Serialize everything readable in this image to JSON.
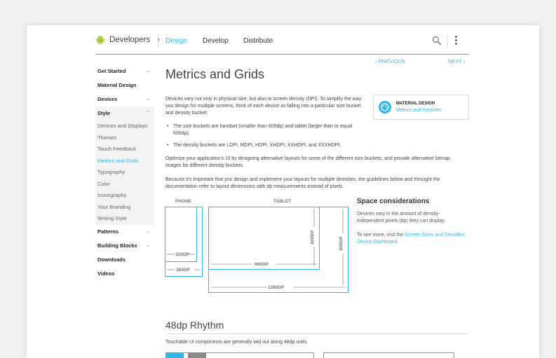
{
  "header": {
    "brand": "Developers",
    "nav": [
      "Design",
      "Develop",
      "Distribute"
    ],
    "active_nav": "Design"
  },
  "icons": [
    "android-icon",
    "search-icon",
    "more-vert-icon",
    "palette-icon"
  ],
  "colors": {
    "accent": "#33b5e5",
    "android_green": "#a4c639"
  },
  "sidebar": {
    "items": [
      {
        "label": "Get Started",
        "chevron": true
      },
      {
        "label": "Material Design"
      },
      {
        "label": "Devices",
        "chevron": true
      },
      {
        "label": "Style",
        "chevron": true
      },
      {
        "label": "Devices and Displays"
      },
      {
        "label": "Themes"
      },
      {
        "label": "Touch Feedback"
      },
      {
        "label": "Metrics and Grids",
        "active": true
      },
      {
        "label": "Typography"
      },
      {
        "label": "Color"
      },
      {
        "label": "Iconography"
      },
      {
        "label": "Your Branding"
      },
      {
        "label": "Writing Style"
      },
      {
        "label": "Patterns",
        "chevron": true
      },
      {
        "label": "Building Blocks",
        "chevron": true
      },
      {
        "label": "Downloads"
      },
      {
        "label": "Videos"
      }
    ]
  },
  "pager": {
    "previous": "‹ PREVIOUS",
    "next": "NEXT ›"
  },
  "main": {
    "title": "Metrics and Grids",
    "intro": "Devices vary not only in physical size, but also in screen density (DPI). To simplify the way you design for multiple screens, think of each device as falling into a particular size bucket and density bucket:",
    "bullets": [
      "The size buckets are handset (smaller than 600dp) and tablet (larger than or equal 600dp).",
      "The density buckets are LDPI, MDPI, HDPI, XHDPI, XXHDPI, and XXXHDPI."
    ],
    "para2": "Optimize your application's UI by designing alternative layouts for some of the different size buckets, and provide alternative bitmap images for different density buckets.",
    "para3": "Because it's important that you design and implement your layouts for multiple densities, the guidelines below and throught the documentation refer to layout dimensions with dp measurements instead of pixels."
  },
  "callout": {
    "title": "MATERIAL DESIGN",
    "link": "Metrics and Keylines"
  },
  "diagram": {
    "phone_label": "PHONE",
    "tablet_label": "TABLET",
    "dims": [
      "320DP",
      "384DP",
      "960DP",
      "1280DP",
      "600DP",
      "800DP"
    ]
  },
  "space": {
    "title": "Space considerations",
    "p1": "Devices vary in the amount of density-independent pixels (dp) they can display.",
    "p2_prefix": "To see more, visit the ",
    "p2_link": "Screen Sizes and Densities Device Dashboard",
    "p2_suffix": "."
  },
  "rhythm": {
    "title": "48dp Rhythm",
    "text": "Touchable UI components are generally laid out along 48dp units."
  }
}
